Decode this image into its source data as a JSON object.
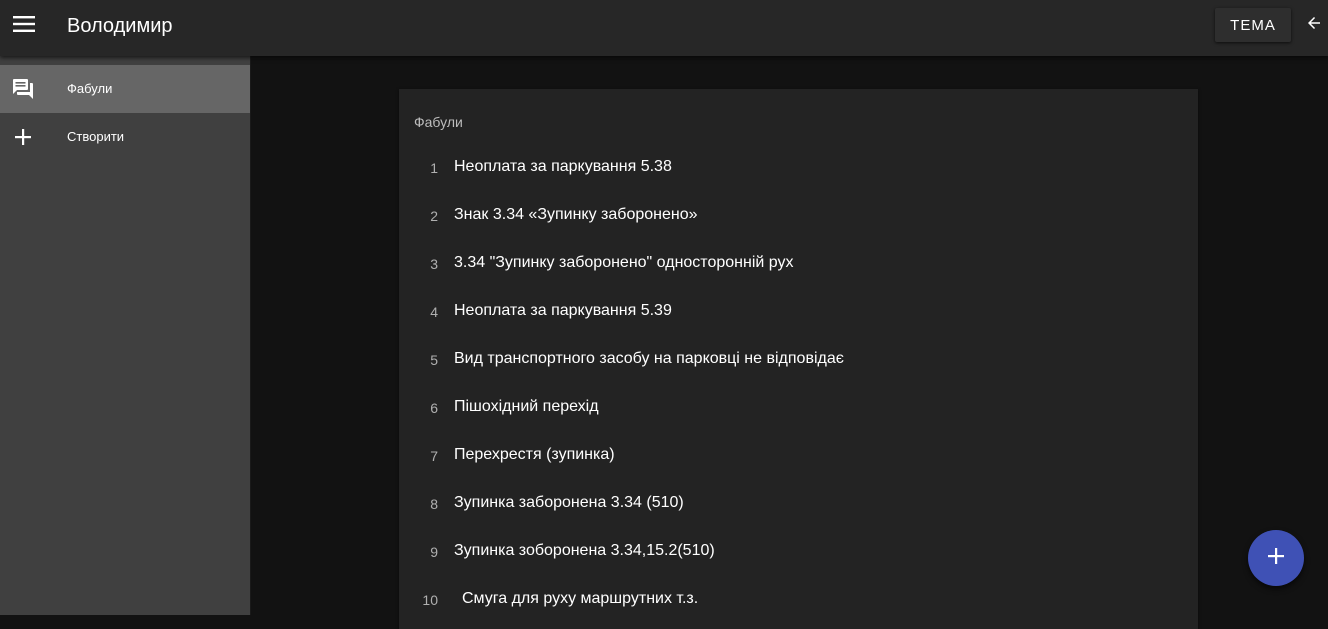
{
  "header": {
    "menu_icon": "hamburger-menu-icon",
    "title": "Володимир",
    "theme_label": "ТЕМА",
    "back_icon": "arrow-left-icon"
  },
  "sidebar": {
    "items": [
      {
        "label": "Фабули",
        "icon": "forum-icon",
        "active": true
      },
      {
        "label": "Створити",
        "icon": "plus-icon",
        "active": false
      }
    ]
  },
  "main": {
    "card_title": "Фабули",
    "items": [
      {
        "num": "1",
        "text": "Неоплата за паркування 5.38"
      },
      {
        "num": "2",
        "text": "Знак 3.34 «Зупинку заборонено»"
      },
      {
        "num": "3",
        "text": "3.34 \"Зупинку заборонено\" односторонній рух"
      },
      {
        "num": "4",
        "text": "Неоплата за паркування 5.39"
      },
      {
        "num": "5",
        "text": "Вид транспортного засобу на парковці не відповідає"
      },
      {
        "num": "6",
        "text": "Пішохідний перехід"
      },
      {
        "num": "7",
        "text": "Перехрестя (зупинка)"
      },
      {
        "num": "8",
        "text": "Зупинка заборонена 3.34 (510)"
      },
      {
        "num": "9",
        "text": "Зупинка зоборонена 3.34,15.2(510)"
      },
      {
        "num": "10",
        "text": "Смуга для руху маршрутних т.з."
      }
    ]
  },
  "fab": {
    "icon": "plus-icon"
  },
  "colors": {
    "appbar": "#272727",
    "sidebar": "#404040",
    "sidebar_active": "#666666",
    "background": "#121212",
    "card": "#232323",
    "fab": "#3f51b5"
  }
}
